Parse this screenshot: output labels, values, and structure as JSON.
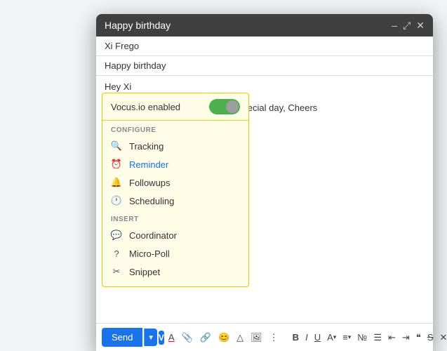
{
  "header": {
    "title": "Happy birthday",
    "minimize": "–",
    "expand": "⤢",
    "close": "✕"
  },
  "fields": {
    "to": "Xi Frego",
    "subject": "Happy birthday",
    "body_line1": "Hey Xi",
    "body_line2": "Wishing you a good one on your special day, Cheers"
  },
  "vocus": {
    "label": "Vocus.io enabled",
    "section_configure": "CONFIGURE",
    "section_insert": "INSERT",
    "menu_items": [
      {
        "id": "tracking",
        "label": "Tracking",
        "icon": "🔍",
        "active": false
      },
      {
        "id": "reminder",
        "label": "Reminder",
        "icon": "⏰",
        "active": true
      },
      {
        "id": "followups",
        "label": "Followups",
        "icon": "🔔",
        "active": false
      },
      {
        "id": "scheduling",
        "label": "Scheduling",
        "icon": "🕐",
        "active": false
      }
    ],
    "insert_items": [
      {
        "id": "coordinator",
        "label": "Coordinator",
        "icon": "💬",
        "active": false
      },
      {
        "id": "micro-poll",
        "label": "Micro-Poll",
        "icon": "?",
        "active": false
      },
      {
        "id": "snippet",
        "label": "Snippet",
        "icon": "✂",
        "active": false
      }
    ]
  },
  "toolbar": {
    "send_label": "Send",
    "send_arrow": "▾",
    "bold": "B",
    "italic": "I",
    "underline": "U",
    "font_color": "A",
    "font_arrow": "▾",
    "align": "≡",
    "align_arrow": "▾",
    "bullets": "☰",
    "numbered": "☷",
    "indent_left": "⇤",
    "indent_right": "⇥",
    "quote": "❝",
    "strikethrough": "S̶",
    "remove_format": "✕",
    "attach": "📎",
    "link": "🔗",
    "emoji": "😊",
    "drive": "△",
    "image": "🖼",
    "more": "⋮"
  }
}
